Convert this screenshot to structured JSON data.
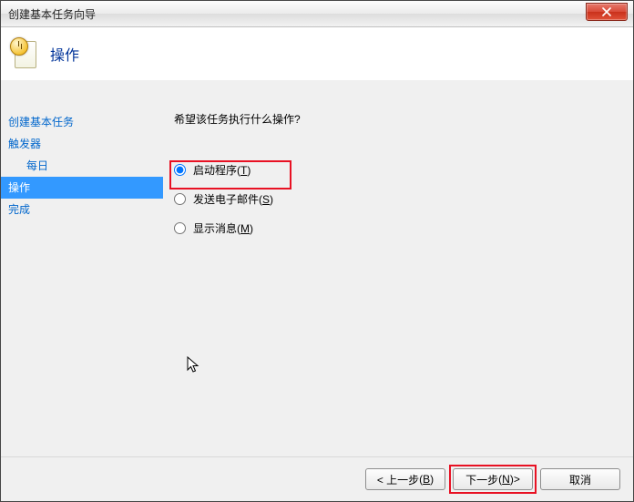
{
  "window": {
    "title": "创建基本任务向导"
  },
  "header": {
    "title": "操作"
  },
  "sidebar": {
    "items": [
      {
        "label": "创建基本任务"
      },
      {
        "label": "触发器"
      },
      {
        "label": "每日"
      },
      {
        "label": "操作"
      },
      {
        "label": "完成"
      }
    ],
    "selected_index": 3,
    "sub_index": 2
  },
  "content": {
    "prompt": "希望该任务执行什么操作?",
    "options": [
      {
        "label": "启动程序",
        "accel": "T",
        "checked": true
      },
      {
        "label": "发送电子邮件",
        "accel": "S",
        "checked": false
      },
      {
        "label": "显示消息",
        "accel": "M",
        "checked": false
      }
    ]
  },
  "footer": {
    "back": {
      "text": "< 上一步",
      "accel": "B"
    },
    "next": {
      "text": "下一步",
      "accel": "N",
      "suffix": " >"
    },
    "cancel": {
      "text": "取消"
    }
  }
}
